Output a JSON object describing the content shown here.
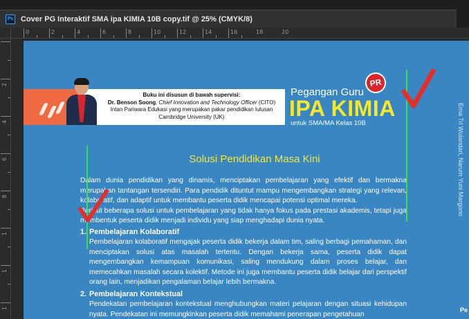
{
  "window": {
    "app_icon": "Ps",
    "tab_title": "Cover PG Interaktif SMA ipa KIMIA 10B copy.tif @ 25% (CMYK/8)"
  },
  "ruler": {
    "top_numbers": [
      "0",
      "2",
      "4",
      "6",
      "8",
      "10",
      "12",
      "14",
      "16",
      "18",
      "20"
    ],
    "left_numbers": [
      "2",
      "4",
      "6",
      "8",
      "1",
      "1",
      "1"
    ]
  },
  "banner": {
    "credit_line1": "Buku ini disusun di bawah supervisi:",
    "credit_name": "Dr. Benson Soong",
    "credit_role": ", Chief Innovation and Technology Officer",
    "credit_org_abbr": " (CITO)",
    "credit_line3": "Intan Pariwara Edukasi yang merupakan pakar pendidikan lulusan",
    "credit_line4": "Cambridge University (UK)",
    "brand_sub": "Pegangan Guru",
    "brand_main": "IPA KIMIA",
    "brand_class": "untuk SMA/MA Kelas 10B",
    "badge": "PR"
  },
  "side": {
    "authors": "Erna Tri Wulandari, Narum Yuni Margono",
    "edge_mark": "Pe"
  },
  "content": {
    "section_title": "Solusi Pendidikan Masa Kini",
    "intro_p1": "Dalam dunia pendidikan yang dinamis, menciptakan pembelajaran yang efektif dan bermakna merupakan tantangan tersendiri. Para pendidik dituntut mampu mengembangkan strategi yang relevan, kolaboratif, dan adaptif untuk membantu peserta didik mencapai potensi optimal mereka.",
    "intro_p2": "Berikut beberapa solusi untuk pembelajaran yang tidak hanya fokus pada prestasi akademis, tetapi juga membentuk peserta didik menjadi individu yang siap menghadapi dunia nyata.",
    "items": [
      {
        "number": "1.",
        "title": "Pembelajaran Kolaboratif",
        "body": "Pembelajaran kolaboratif mengajak peserta didik bekerja dalam tim, saling berbagi pemahaman, dan menciptakan solusi atas masalah tertentu. Dengan bekerja sama, peserta didik dapat mengembangkan kemampuan komunikasi, saling mendukung dalam proses belajar, dan memecahkan masalah secara kolektif. Metode ini juga membantu peserta didik belajar dari perspektif orang lain, menjadikan pengalaman belajar lebih bermakna."
      },
      {
        "number": "2.",
        "title": "Pembelajaran Kontekstual",
        "body": "Pendekatan pembelajaran kontekstual menghubungkan materi pelajaran dengan situasi kehidupan nyata. Pendekatan ini memungkinkan peserta didik memahami penerapan pengetahuan"
      }
    ]
  },
  "colors": {
    "page_blue": "#3a86c3",
    "title_yellow": "#f5e82c",
    "guide_green": "#39e04a",
    "check_red": "#e0302d",
    "accent_orange": "#ef6a43"
  }
}
